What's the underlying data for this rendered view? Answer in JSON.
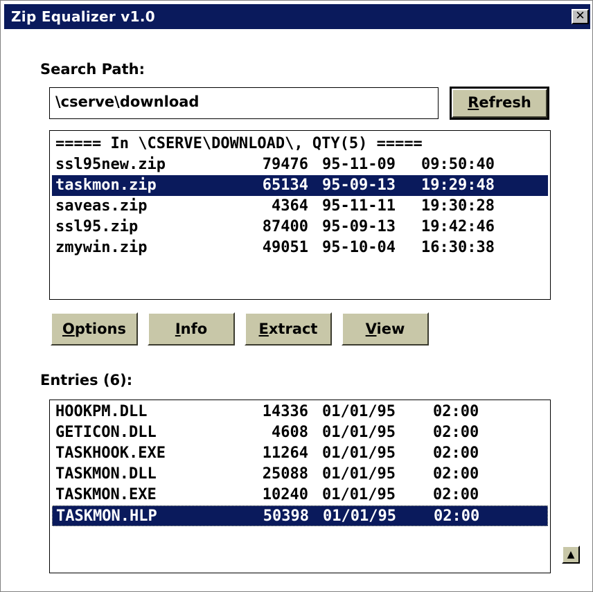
{
  "window": {
    "title": "Zip Equalizer v1.0",
    "close_glyph": "✕"
  },
  "search": {
    "label": "Search Path:",
    "value": "\\cserve\\download"
  },
  "refresh_button": {
    "mnemonic": "R",
    "rest": "efresh"
  },
  "files": {
    "header": "===== In \\CSERVE\\DOWNLOAD\\, QTY(5) =====",
    "rows": [
      {
        "name": "ssl95new.zip",
        "size": "79476",
        "date": "95-11-09",
        "time": "09:50:40"
      },
      {
        "name": "taskmon.zip",
        "size": "65134",
        "date": "95-09-13",
        "time": "19:29:48",
        "selected": true
      },
      {
        "name": "saveas.zip",
        "size": "4364",
        "date": "95-11-11",
        "time": "19:30:28"
      },
      {
        "name": "ssl95.zip",
        "size": "87400",
        "date": "95-09-13",
        "time": "19:42:46"
      },
      {
        "name": "zmywin.zip",
        "size": "49051",
        "date": "95-10-04",
        "time": "16:30:38"
      }
    ]
  },
  "buttons": {
    "options": {
      "mnemonic": "O",
      "rest": "ptions"
    },
    "info": {
      "mnemonic": "I",
      "rest": "nfo"
    },
    "extract": {
      "mnemonic": "E",
      "rest": "xtract"
    },
    "view": {
      "mnemonic": "V",
      "rest": "iew"
    }
  },
  "entries": {
    "label": "Entries (6):",
    "rows": [
      {
        "name": "HOOKPM.DLL",
        "size": "14336",
        "date": "01/01/95",
        "time": "02:00"
      },
      {
        "name": "GETICON.DLL",
        "size": "4608",
        "date": "01/01/95",
        "time": "02:00"
      },
      {
        "name": "TASKHOOK.EXE",
        "size": "11264",
        "date": "01/01/95",
        "time": "02:00"
      },
      {
        "name": "TASKMON.DLL",
        "size": "25088",
        "date": "01/01/95",
        "time": "02:00"
      },
      {
        "name": "TASKMON.EXE",
        "size": "10240",
        "date": "01/01/95",
        "time": "02:00"
      },
      {
        "name": "TASKMON.HLP",
        "size": "50398",
        "date": "01/01/95",
        "time": "02:00",
        "selected": true
      }
    ]
  },
  "scroll_button": {
    "icon": "up-arrow-icon",
    "glyph": "▲"
  },
  "colors": {
    "title_bar": "#0a1a5c",
    "selection": "#0a1a5c",
    "button_face": "#c8c7a8"
  }
}
